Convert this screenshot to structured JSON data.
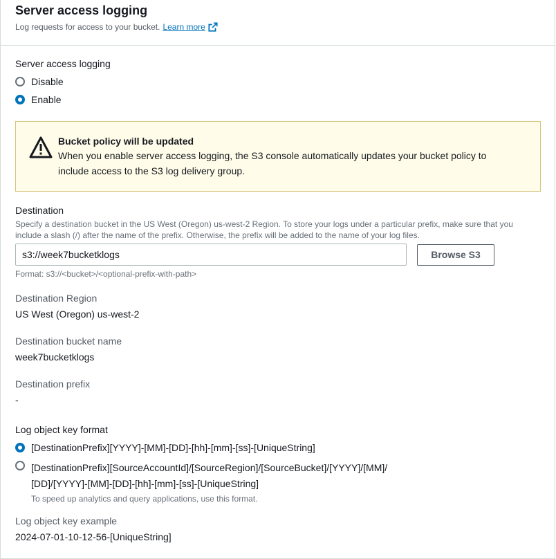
{
  "header": {
    "title": "Server access logging",
    "description": "Log requests for access to your bucket.",
    "learn_more": "Learn more"
  },
  "logging": {
    "label": "Server access logging",
    "options": [
      "Disable",
      "Enable"
    ],
    "selected": "Enable"
  },
  "alert": {
    "title": "Bucket policy will be updated",
    "body_line1": "When you enable server access logging, the S3 console automatically updates your bucket policy to",
    "body_line2": "include access to the S3 log delivery group.",
    "icon": "warning-icon"
  },
  "destination": {
    "label": "Destination",
    "hint_line1": "Specify a destination bucket in the US West (Oregon) us-west-2 Region. To store your logs under a particular prefix, make sure that you",
    "hint_line2": "include a slash (/) after the name of the prefix. Otherwise, the prefix will be added to the name of your log files.",
    "value": "s3://week7bucketklogs",
    "browse_label": "Browse S3",
    "format_hint": "Format: s3://<bucket>/<optional-prefix-with-path>"
  },
  "details": {
    "region_label": "Destination Region",
    "region_value": "US West (Oregon) us-west-2",
    "bucket_label": "Destination bucket name",
    "bucket_value": "week7bucketklogs",
    "prefix_label": "Destination prefix",
    "prefix_value": "-"
  },
  "key_format": {
    "label": "Log object key format",
    "option1": "[DestinationPrefix][YYYY]-[MM]-[DD]-[hh]-[mm]-[ss]-[UniqueString]",
    "option2_line1": "[DestinationPrefix][SourceAccountId]/[SourceRegion]/[SourceBucket]/[YYYY]/[MM]/",
    "option2_line2": "[DD]/[YYYY]-[MM]-[DD]-[hh]-[mm]-[ss]-[UniqueString]",
    "option2_hint": "To speed up analytics and query applications, use this format.",
    "selected": "option1"
  },
  "example": {
    "label": "Log object key example",
    "value": "2024-07-01-10-12-56-[UniqueString]"
  },
  "colors": {
    "accent": "#0073bb",
    "warning_bg": "#fffce9",
    "warning_border": "#d4c47a"
  }
}
